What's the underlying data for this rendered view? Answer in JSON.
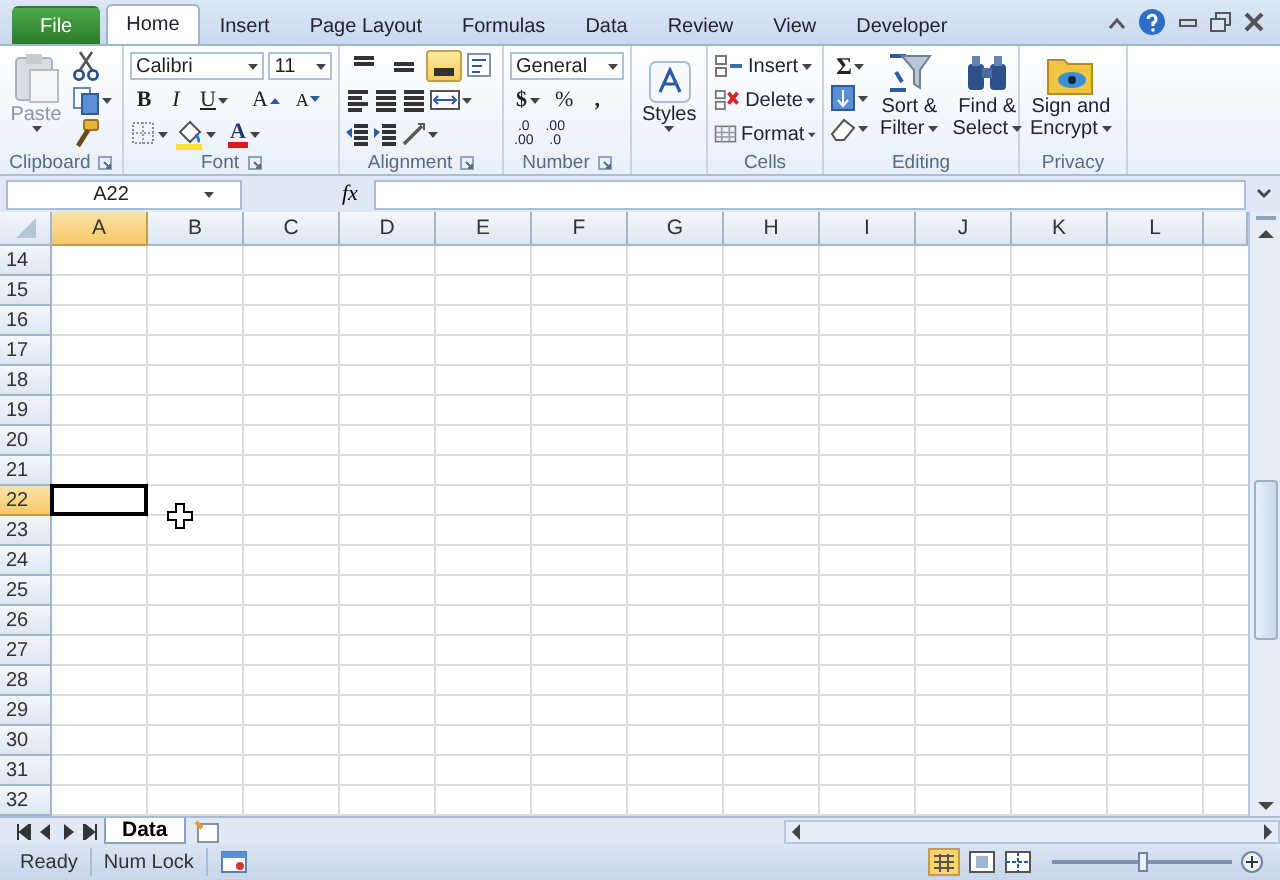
{
  "tabs": [
    {
      "label": "File",
      "kind": "file",
      "selected": false
    },
    {
      "label": "Home",
      "kind": "tab",
      "selected": true
    },
    {
      "label": "Insert",
      "kind": "tab",
      "selected": false
    },
    {
      "label": "Page Layout",
      "kind": "tab",
      "selected": false
    },
    {
      "label": "Formulas",
      "kind": "tab",
      "selected": false
    },
    {
      "label": "Data",
      "kind": "tab",
      "selected": false
    },
    {
      "label": "Review",
      "kind": "tab",
      "selected": false
    },
    {
      "label": "View",
      "kind": "tab",
      "selected": false
    },
    {
      "label": "Developer",
      "kind": "tab",
      "selected": false
    }
  ],
  "clipboard": {
    "label": "Clipboard",
    "paste": "Paste"
  },
  "font": {
    "label": "Font",
    "family": "Calibri",
    "size": "11",
    "bold": "B",
    "italic": "I",
    "underline": "U",
    "grow": "A",
    "shrink": "A",
    "color_letter": "A"
  },
  "alignment": {
    "label": "Alignment",
    "vertical_align": [
      {
        "selected": false
      },
      {
        "selected": false
      },
      {
        "selected": true
      }
    ]
  },
  "number": {
    "label": "Number",
    "format": "General",
    "currency": "$",
    "percent": "%",
    "comma": ",",
    "increase_decimal": [
      ".0",
      ".00"
    ],
    "decrease_decimal": [
      ".00",
      ".0"
    ]
  },
  "styles": {
    "label": "Styles"
  },
  "cells": {
    "label": "Cells",
    "items": [
      "Insert",
      "Delete",
      "Format"
    ]
  },
  "editing": {
    "label": "Editing",
    "sum": "Σ",
    "sort": [
      "Sort &",
      "Filter"
    ],
    "find": [
      "Find &",
      "Select"
    ]
  },
  "privacy": {
    "label": "Privacy",
    "button": [
      "Sign and",
      "Encrypt"
    ]
  },
  "formula_bar": {
    "name_box": "A22",
    "fx": "fx"
  },
  "grid": {
    "columns": [
      {
        "label": "A",
        "selected": true
      },
      {
        "label": "B",
        "selected": false
      },
      {
        "label": "C",
        "selected": false
      },
      {
        "label": "D",
        "selected": false
      },
      {
        "label": "E",
        "selected": false
      },
      {
        "label": "F",
        "selected": false
      },
      {
        "label": "G",
        "selected": false
      },
      {
        "label": "H",
        "selected": false
      },
      {
        "label": "I",
        "selected": false
      },
      {
        "label": "J",
        "selected": false
      },
      {
        "label": "K",
        "selected": false
      },
      {
        "label": "L",
        "selected": false
      }
    ],
    "rows": [
      {
        "label": "14",
        "selected": false
      },
      {
        "label": "15",
        "selected": false
      },
      {
        "label": "16",
        "selected": false
      },
      {
        "label": "17",
        "selected": false
      },
      {
        "label": "18",
        "selected": false
      },
      {
        "label": "19",
        "selected": false
      },
      {
        "label": "20",
        "selected": false
      },
      {
        "label": "21",
        "selected": false
      },
      {
        "label": "22",
        "selected": true
      },
      {
        "label": "23",
        "selected": false
      },
      {
        "label": "24",
        "selected": false
      },
      {
        "label": "25",
        "selected": false
      },
      {
        "label": "26",
        "selected": false
      },
      {
        "label": "27",
        "selected": false
      },
      {
        "label": "28",
        "selected": false
      },
      {
        "label": "29",
        "selected": false
      },
      {
        "label": "30",
        "selected": false
      },
      {
        "label": "31",
        "selected": false
      },
      {
        "label": "32",
        "selected": false
      }
    ]
  },
  "sheets": [
    {
      "label": "Data",
      "selected": true
    }
  ],
  "status_bar": {
    "items": [
      "Ready",
      "Num Lock"
    ]
  },
  "zoom_slider": {
    "level": 0.5
  }
}
